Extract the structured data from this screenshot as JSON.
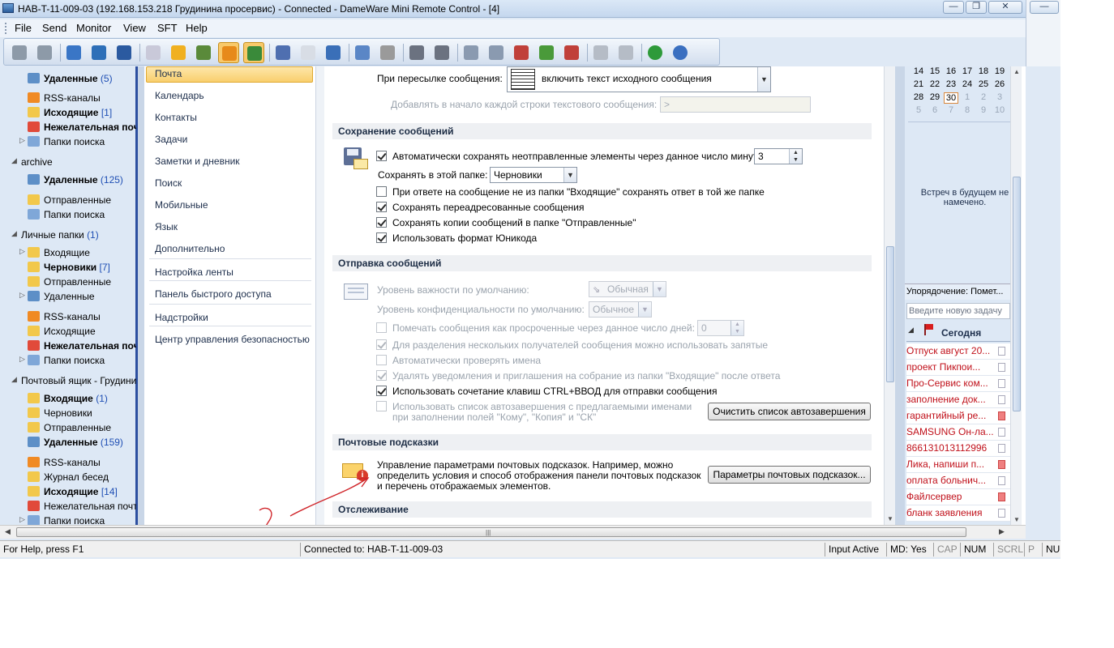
{
  "window": {
    "title": "HAB-T-11-009-03 (192.168.153.218 Грудинина просервис) - Connected - DameWare Mini Remote Control - [4]",
    "caption_buttons": [
      "minimize",
      "restore",
      "close"
    ]
  },
  "menu": [
    "File",
    "Send",
    "Monitor",
    "View",
    "SFT",
    "Help"
  ],
  "toolbar_icons": [
    "computer-icon",
    "computer-dropdown-icon",
    "disconnect-icon",
    "remote-view-icon",
    "move-icon",
    "abc-font-icon",
    "lock-icon",
    "glasses-view-icon",
    "keyboard-active-icon",
    "pointer-select-icon",
    "pointer-assist-icon",
    "blank-window-icon",
    "grid-layout-icon",
    "settings-icon",
    "disabled-circle-icon",
    "print-icon",
    "print-config-icon",
    "network-icon",
    "network-copy-icon",
    "delete-network-icon",
    "folder-share-icon",
    "folder-transfer-icon",
    "windows-icon",
    "lock-alt-icon",
    "info-icon",
    "help-icon"
  ],
  "nav": {
    "items": [
      {
        "label": "Удаленные",
        "count": "(5)",
        "bold": true
      },
      {
        "label": "RSS-каналы",
        "count": "",
        "bold": false
      },
      {
        "label": "Исходящие",
        "count": "[1]",
        "bold": true
      },
      {
        "label": "Нежелательная почт",
        "count": "",
        "bold": true
      },
      {
        "label": "Папки поиска",
        "count": "",
        "bold": false
      },
      {
        "label": "archive",
        "count": "",
        "bold": false
      },
      {
        "label": "Удаленные",
        "count": "(125)",
        "bold": true
      },
      {
        "label": "Отправленные",
        "count": "",
        "bold": false
      },
      {
        "label": "Папки поиска",
        "count": "",
        "bold": false
      },
      {
        "label": "Личные папки",
        "count": "(1)",
        "bold": false
      },
      {
        "label": "Входящие",
        "count": "",
        "bold": false
      },
      {
        "label": "Черновики",
        "count": "[7]",
        "bold": true
      },
      {
        "label": "Отправленные",
        "count": "",
        "bold": false
      },
      {
        "label": "Удаленные",
        "count": "",
        "bold": false
      },
      {
        "label": "RSS-каналы",
        "count": "",
        "bold": false
      },
      {
        "label": "Исходящие",
        "count": "",
        "bold": false
      },
      {
        "label": "Нежелательная почт",
        "count": "",
        "bold": true
      },
      {
        "label": "Папки поиска",
        "count": "",
        "bold": false
      },
      {
        "label": "Почтовый ящик - Грудини",
        "count": "",
        "bold": false
      },
      {
        "label": "Входящие",
        "count": "(1)",
        "bold": true
      },
      {
        "label": "Черновики",
        "count": "",
        "bold": false
      },
      {
        "label": "Отправленные",
        "count": "",
        "bold": false
      },
      {
        "label": "Удаленные",
        "count": "(159)",
        "bold": true
      },
      {
        "label": "RSS-каналы",
        "count": "",
        "bold": false
      },
      {
        "label": "Журнал бесед",
        "count": "",
        "bold": false
      },
      {
        "label": "Исходящие",
        "count": "[14]",
        "bold": true
      },
      {
        "label": "Нежелательная почт",
        "count": "",
        "bold": false
      },
      {
        "label": "Папки поиска",
        "count": "",
        "bold": false
      }
    ]
  },
  "categories": [
    "Почта",
    "Календарь",
    "Контакты",
    "Задачи",
    "Заметки и дневник",
    "Поиск",
    "Мобильные",
    "Язык",
    "Дополнительно",
    "Настройка ленты",
    "Панель быстрого доступа",
    "Надстройки",
    "Центр управления безопасностью"
  ],
  "options": {
    "forward_label": "При пересылке сообщения:",
    "forward_value": "включить текст исходного сообщения",
    "prefix_label": "Добавлять в начало каждой строки текстового сообщения:",
    "prefix_value": ">",
    "save_section": "Сохранение сообщений",
    "autosave_label": "Автоматически сохранять неотправленные элементы через данное число минут:",
    "autosave_value": "3",
    "save_folder_label": "Сохранять в этой папке:",
    "save_folder_value": "Черновики",
    "reply_not_inbox": "При ответе на сообщение не из папки \"Входящие\" сохранять ответ в той же папке",
    "save_forwarded": "Сохранять переадресованные сообщения",
    "save_copies": "Сохранять копии сообщений в папке \"Отправленные\"",
    "use_unicode": "Использовать формат Юникода",
    "send_section": "Отправка сообщений",
    "importance_label": "Уровень важности по умолчанию:",
    "importance_value": "Обычная",
    "sensitivity_label": "Уровень конфиденциальности по умолчанию:",
    "sensitivity_value": "Обычное",
    "mark_expired": "Помечать сообщения как просроченные через данное число дней:",
    "expired_value": "0",
    "commas": "Для разделения нескольких получателей сообщения можно использовать запятые",
    "check_names": "Автоматически проверять имена",
    "delete_notices": "Удалять уведомления и приглашения на собрание из папки \"Входящие\" после ответа",
    "ctrl_enter": "Использовать сочетание клавиш CTRL+ВВОД для отправки сообщения",
    "autocomplete_line1": "Использовать список автозавершения с предлагаемыми именами",
    "autocomplete_line2": "при заполнении полей \"Кому\", \"Копия\" и \"СК\"",
    "clear_autocomplete": "Очистить список автозавершения",
    "tips_section": "Почтовые подсказки",
    "tips_text_1": "Управление параметрами почтовых подсказок. Например, можно",
    "tips_text_2": "определить условия и способ отображения панели почтовых подсказок",
    "tips_text_3": "и перечень отображаемых элементов.",
    "tips_button": "Параметры почтовых подсказок...",
    "tracking_section": "Отслеживание"
  },
  "calendar": {
    "rows": [
      [
        "14",
        "15",
        "16",
        "17",
        "18",
        "19"
      ],
      [
        "21",
        "22",
        "23",
        "24",
        "25",
        "26"
      ],
      [
        "28",
        "29",
        "30",
        "1",
        "2",
        "3"
      ],
      [
        "5",
        "6",
        "7",
        "8",
        "9",
        "10"
      ]
    ],
    "today": "30",
    "no_meetings": "Встреч в будущем не намечено."
  },
  "tasks": {
    "arrange": "Упорядочение: Помет...",
    "new_task_placeholder": "Введите новую задачу",
    "group": "Сегодня",
    "items": [
      {
        "text": "Отпуск август 20...",
        "flag": false
      },
      {
        "text": "проект Пикпои...",
        "flag": false
      },
      {
        "text": "Про-Сервис ком...",
        "flag": false
      },
      {
        "text": "заполнение док...",
        "flag": false
      },
      {
        "text": "гарантийный ре...",
        "flag": true
      },
      {
        "text": "SAMSUNG Он-ла...",
        "flag": false
      },
      {
        "text": "866131013112996",
        "flag": false
      },
      {
        "text": "Лика, напиши п...",
        "flag": true
      },
      {
        "text": "оплата больнич...",
        "flag": false
      },
      {
        "text": "Файлсервер",
        "flag": true
      },
      {
        "text": "бланк заявления",
        "flag": false
      }
    ]
  },
  "status": {
    "help": "For Help, press F1",
    "connected": "Connected to: HAB-T-11-009-03",
    "input": "Input Active",
    "md": "MD: Yes",
    "cap": "CAP",
    "num": "NUM",
    "scrl": "SCRL",
    "p": "P",
    "nu": "NU"
  },
  "annotation": "?"
}
